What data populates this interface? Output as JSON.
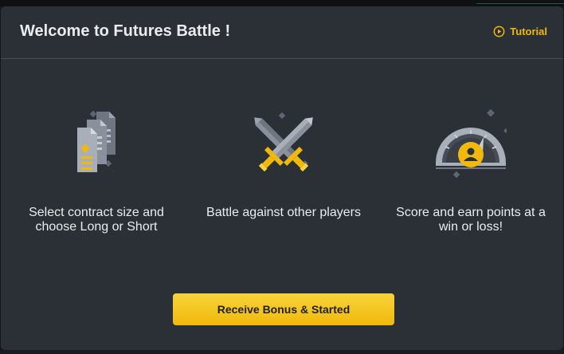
{
  "modal": {
    "title": "Welcome to Futures Battle !",
    "tutorial_label": "Tutorial",
    "tutorial_icon": "play-circle-icon",
    "features": [
      {
        "icon": "contract-documents-icon",
        "text": "Select contract size and choose Long or Short"
      },
      {
        "icon": "crossed-swords-icon",
        "text": "Battle against other players"
      },
      {
        "icon": "score-gauge-icon",
        "text": "Score and earn points at a win or loss!"
      }
    ],
    "cta_label": "Receive Bonus & Started"
  },
  "colors": {
    "accent": "#f0b90b",
    "modal_bg": "#2b2f36",
    "text": "#eaecef",
    "divider": "#474d57"
  }
}
